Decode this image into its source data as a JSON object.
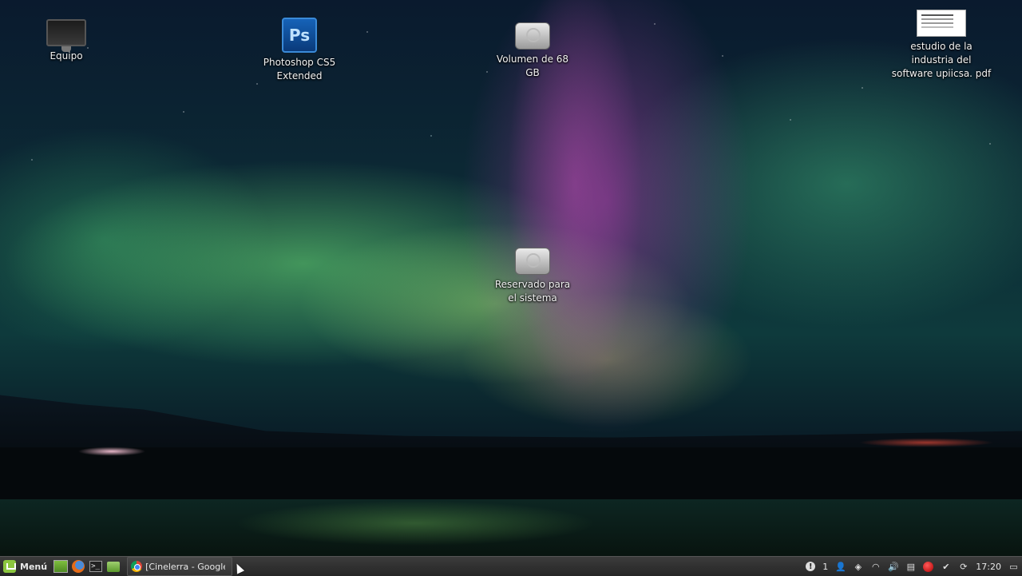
{
  "desktop": {
    "icons": [
      {
        "label": "Equipo"
      },
      {
        "label": "Photoshop CS5 Extended",
        "glyph": "Ps"
      },
      {
        "label": "Volumen de 68 GB"
      },
      {
        "label": "estudio de la industria del software upiicsa. pdf"
      },
      {
        "label": "Reservado para el sistema"
      }
    ]
  },
  "taskbar": {
    "menu_label": "Menú",
    "terminal_glyph": ">_",
    "task_label": "[Cinelerra - Google C",
    "tray": {
      "alert_glyph": "!",
      "workspace": "1",
      "user_glyph": "👤",
      "network_glyph": "◈",
      "wifi_glyph": "◠",
      "volume_glyph": "🔊",
      "clip_glyph": "▤",
      "shield_glyph": "✔",
      "updates_glyph": "⟳",
      "show_desktop_glyph": "▭",
      "clock": "17:20"
    }
  },
  "colors": {
    "taskbar_bg": "#2e2e2e",
    "mint_green": "#8cc63f",
    "photoshop_blue": "#0a3a7a"
  }
}
